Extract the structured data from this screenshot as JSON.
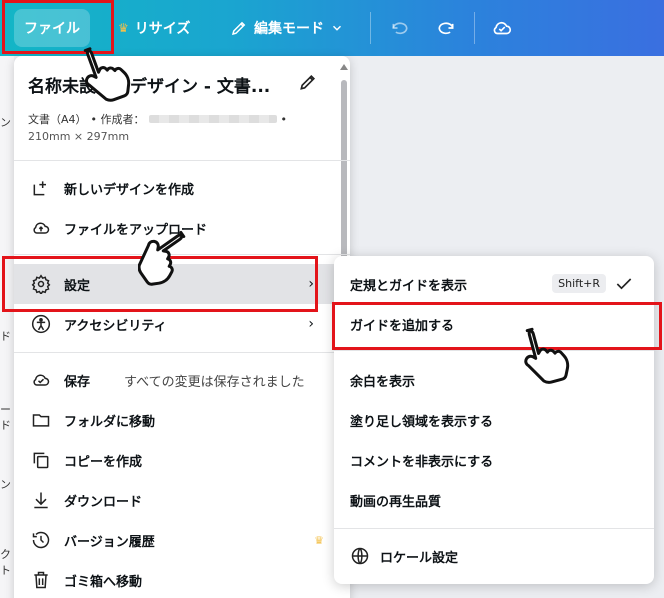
{
  "toolbar": {
    "file_label": "ファイル",
    "resize_label": "リサイズ",
    "edit_mode_label": "編集モード"
  },
  "left_strip": [
    "ン",
    "ド",
    "ード",
    "ン",
    "クト"
  ],
  "menu": {
    "doc_title": "名称未設定のデザイン - 文書...",
    "doc_meta_type": "文書（A4）",
    "doc_meta_author_label": "• 作成者：",
    "doc_meta_dot": "•",
    "doc_meta_size": "210mm × 297mm",
    "items": [
      {
        "label": "新しいデザインを作成",
        "icon": "new-design-icon"
      },
      {
        "label": "ファイルをアップロード",
        "icon": "upload-cloud-icon"
      },
      {
        "label": "設定",
        "icon": "gear-icon"
      },
      {
        "label": "アクセシビリティ",
        "icon": "accessibility-icon"
      },
      {
        "label": "保存",
        "sub": "すべての変更は保存されました",
        "icon": "cloud-check-icon"
      },
      {
        "label": "フォルダに移動",
        "icon": "folder-icon"
      },
      {
        "label": "コピーを作成",
        "icon": "copy-icon"
      },
      {
        "label": "ダウンロード",
        "icon": "download-icon"
      },
      {
        "label": "バージョン履歴",
        "icon": "history-icon"
      },
      {
        "label": "ゴミ箱へ移動",
        "icon": "trash-icon"
      }
    ]
  },
  "submenu": {
    "items": [
      {
        "label": "定規とガイドを表示",
        "shortcut": "Shift+R",
        "checked": true
      },
      {
        "label": "ガイドを追加する"
      },
      {
        "label": "余白を表示"
      },
      {
        "label": "塗り足し領域を表示する"
      },
      {
        "label": "コメントを非表示にする"
      },
      {
        "label": "動画の再生品質"
      },
      {
        "label": "ロケール設定",
        "icon": "globe-icon"
      }
    ]
  },
  "colors": {
    "highlight": "#e3141a",
    "crown": "#f3c04a",
    "active_bg": "#e2e3e6"
  }
}
